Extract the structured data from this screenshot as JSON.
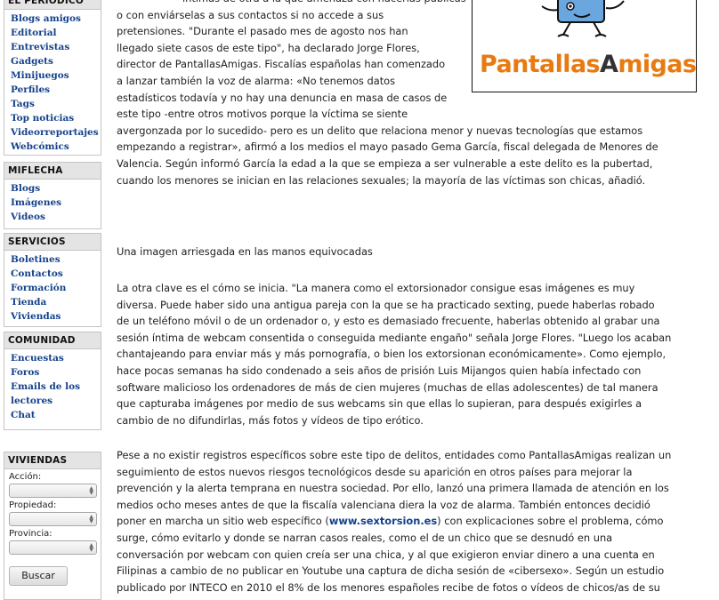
{
  "sidebar": {
    "periodico": {
      "title": "EL PERIÓDICO",
      "items": [
        "Blogs amigos",
        "Editorial",
        "Entrevistas",
        "Gadgets",
        "Minijuegos",
        "Perfiles",
        "Tags",
        "Top noticias",
        "Videorreportajes",
        "Webcómics"
      ]
    },
    "miflecha": {
      "title": "MIFLECHA",
      "items": [
        "Blogs",
        "Imágenes",
        "Videos"
      ]
    },
    "servicios": {
      "title": "SERVICIOS",
      "items": [
        "Boletines",
        "Contactos",
        "Formación",
        "Tienda",
        "Viviendas"
      ]
    },
    "comunidad": {
      "title": "COMUNIDAD",
      "items": [
        "Encuestas",
        "Foros",
        "Emails de los",
        "lectores",
        "Chat"
      ]
    },
    "viviendas": {
      "title": "VIVIENDAS",
      "accion_label": "Acción:",
      "propiedad_label": "Propiedad:",
      "provincia_label": "Provincia:",
      "search_button": "Buscar"
    }
  },
  "logo": {
    "text_part1": "Pantallas",
    "text_part2": "A",
    "text_part3": "migas"
  },
  "article": {
    "p1_lines": [
      "íntimas de otra a la que amenaza con hacerlas públicas",
      "o con enviárselas a sus contactos si no accede a sus",
      "pretensiones. \"Durante el pasado mes de agosto nos han",
      "llegado siete casos de este tipo\", ha declarado Jorge Flores,",
      "director de PantallasAmigas. Fiscalías españolas han comenzado",
      "a lanzar también la voz de alarma: «No tenemos datos",
      "estadísticos todavía y no hay una denuncia en masa de casos de",
      "este tipo -entre otros motivos porque la víctima se siente",
      "avergonzada por lo sucedido- pero es un delito que relaciona menor y nuevas tecnologías que estamos",
      "empezando a registrar», afirmó a los medios el mayo pasado Gema García, fiscal delegada de Menores de",
      "Valencia. Según informó García la edad a la que se empieza a ser vulnerable a este delito es la pubertad,",
      "cuando los menores se inician en las relaciones sexuales; la mayoría de las víctimas son chicas, añadió."
    ],
    "subheading": "Una imagen arriesgada en las manos equivocadas",
    "p2_lines": [
      "La otra clave es el cómo se inicia. \"La manera como el extorsionador consigue esas imágenes es muy",
      "diversa. Puede haber sido una antigua pareja con la que se ha practicado sexting, puede haberlas robado",
      "de un teléfono móvil o de un ordenador o, y esto es demasiado frecuente, haberlas obtenido al grabar una",
      "sesión íntima de webcam consentida o conseguida mediante engaño\" señala Jorge Flores. \"Luego los acaban",
      "chantajeando para enviar más y más pornografía, o bien los extorsionan económicamente». Como ejemplo,",
      "hace pocas semanas ha sido condenado a seis años de prisión Luis Mijangos quien había infectado con",
      "software malicioso los ordenadores de más de cien mujeres (muchas de ellas adolescentes) de tal manera",
      "que capturaba imágenes por medio de sus webcams sin que ellas lo supieran, para después exigirles a",
      "cambio de no difundirlas, más fotos y vídeos de tipo erótico."
    ],
    "p3_lines": [
      "Pese a no existir registros específicos sobre este tipo de delitos, entidades como PantallasAmigas realizan un",
      "seguimiento de estos nuevos riesgos tecnológicos desde su aparición en otros países para mejorar la",
      "prevención y la alerta temprana en nuestra sociedad. Por ello, lanzó una primera llamada de atención en los",
      "medios ocho meses antes de que la fiscalía valenciana diera la voz de alarma. También entonces decidió"
    ],
    "p3_link_pre": "poner en marcha un sitio web específico (",
    "p3_link": "www.sextorsion.es",
    "p3_link_post": ") con explicaciones sobre el problema, cómo",
    "p3_rest": [
      "surge, cómo evitarlo y donde se narran casos reales, como el de un chico que se desnudó en una",
      "conversación por webcam con quien creía ser una chica, y al que exigieron enviar dinero a una cuenta en",
      "Filipinas a cambio de no publicar en Youtube una captura de dicha sesión de «cibersexo». Según un estudio",
      "publicado por INTECO en 2010 el 8% de los menores españoles recibe de fotos o vídeos de chicos/as de su"
    ]
  },
  "colors": {
    "link": "#14418b",
    "header_bg": "#e4e4e4",
    "logo_orange": "#e87a12"
  }
}
